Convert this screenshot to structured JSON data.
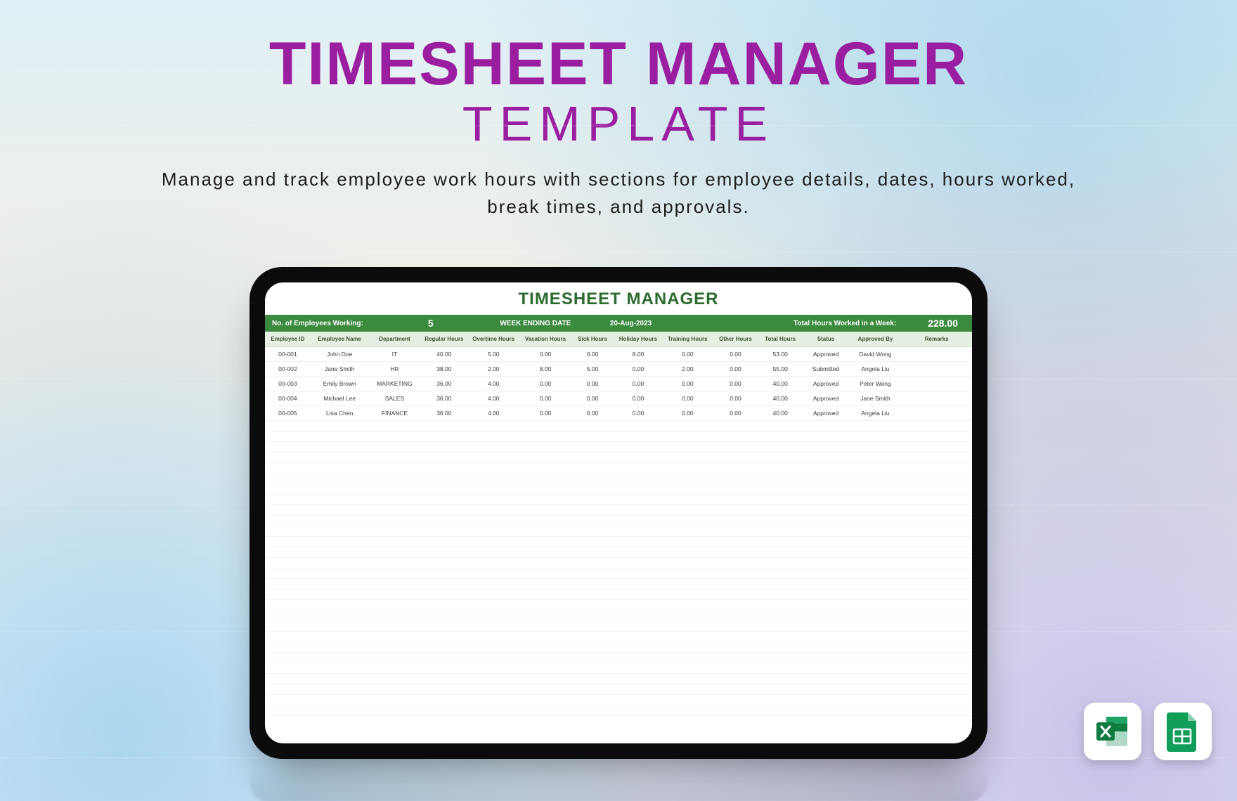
{
  "hero": {
    "title": "TIMESHEET MANAGER",
    "subtitle": "TEMPLATE",
    "description": "Manage and track employee work hours with sections for employee details, dates, hours worked, break times, and approvals."
  },
  "sheet": {
    "title": "TIMESHEET MANAGER",
    "summary": {
      "employees_label": "No. of Employees Working:",
      "employees_value": "5",
      "week_ending_label": "WEEK ENDING DATE",
      "week_ending_value": "20-Aug-2023",
      "total_hours_label": "Total Hours Worked in a Week:",
      "total_hours_value": "228.00"
    },
    "columns": [
      "Employee ID",
      "Employee Name",
      "Department",
      "Regular Hours",
      "Overtime Hours",
      "Vacation Hours",
      "Sick Hours",
      "Holiday Hours",
      "Training Hours",
      "Other Hours",
      "Total Hours",
      "Status",
      "Approved By",
      "Remarks"
    ],
    "rows": [
      {
        "id": "00-001",
        "name": "John Doe",
        "dept": "IT",
        "reg": "40.00",
        "ot": "5.00",
        "vac": "0.00",
        "sick": "0.00",
        "hol": "8.00",
        "train": "0.00",
        "other": "0.00",
        "total": "53.00",
        "status": "Approved",
        "appr": "David Wong",
        "rem": ""
      },
      {
        "id": "00-002",
        "name": "Jane Smith",
        "dept": "HR",
        "reg": "38.00",
        "ot": "2.00",
        "vac": "8.00",
        "sick": "5.00",
        "hol": "0.00",
        "train": "2.00",
        "other": "0.00",
        "total": "55.00",
        "status": "Submitted",
        "appr": "Angela Liu",
        "rem": ""
      },
      {
        "id": "00-003",
        "name": "Emily Brown",
        "dept": "MARKETING",
        "reg": "36.00",
        "ot": "4.00",
        "vac": "0.00",
        "sick": "0.00",
        "hol": "0.00",
        "train": "0.00",
        "other": "0.00",
        "total": "40.00",
        "status": "Approved",
        "appr": "Peter Wang",
        "rem": ""
      },
      {
        "id": "00-004",
        "name": "Michael Lee",
        "dept": "SALES",
        "reg": "36.00",
        "ot": "4.00",
        "vac": "0.00",
        "sick": "0.00",
        "hol": "0.00",
        "train": "0.00",
        "other": "0.00",
        "total": "40.00",
        "status": "Approved",
        "appr": "Jane Smith",
        "rem": ""
      },
      {
        "id": "00-005",
        "name": "Lisa Chen",
        "dept": "FINANCE",
        "reg": "36.00",
        "ot": "4.00",
        "vac": "0.00",
        "sick": "0.00",
        "hol": "0.00",
        "train": "0.00",
        "other": "0.00",
        "total": "40.00",
        "status": "Approved",
        "appr": "Angela Liu",
        "rem": ""
      }
    ],
    "empty_rows": 28
  },
  "badges": {
    "excel": "excel-icon",
    "sheets": "sheets-icon"
  }
}
